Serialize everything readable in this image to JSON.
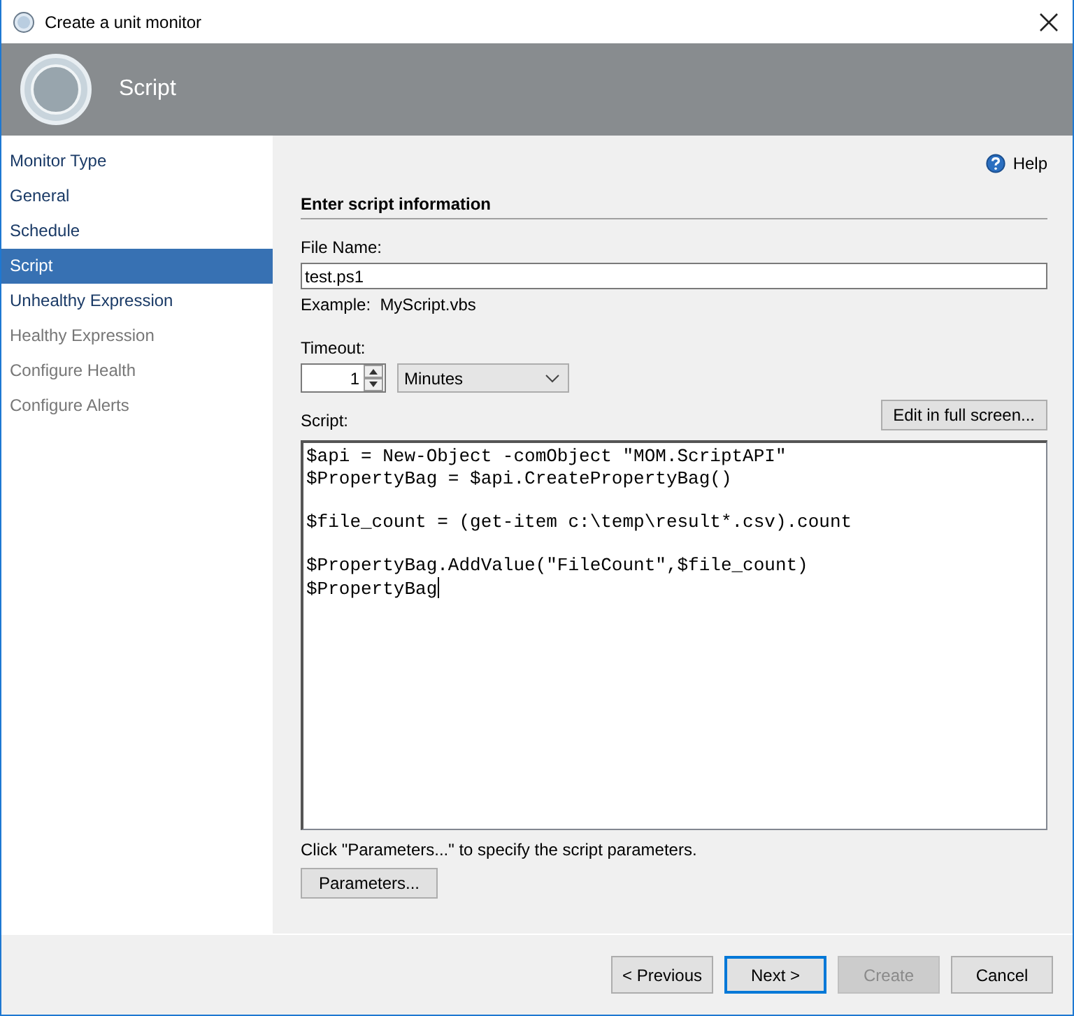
{
  "window": {
    "title": "Create a unit monitor"
  },
  "header": {
    "title": "Script"
  },
  "sidebar": {
    "items": [
      {
        "label": "Monitor Type",
        "selected": false,
        "disabled": false
      },
      {
        "label": "General",
        "selected": false,
        "disabled": false
      },
      {
        "label": "Schedule",
        "selected": false,
        "disabled": false
      },
      {
        "label": "Script",
        "selected": true,
        "disabled": false
      },
      {
        "label": "Unhealthy Expression",
        "selected": false,
        "disabled": false
      },
      {
        "label": "Healthy Expression",
        "selected": false,
        "disabled": true
      },
      {
        "label": "Configure Health",
        "selected": false,
        "disabled": true
      },
      {
        "label": "Configure Alerts",
        "selected": false,
        "disabled": true
      }
    ]
  },
  "help": "Help",
  "section_title": "Enter script information",
  "file_name": {
    "label": "File Name:",
    "value": "test.ps1",
    "example": "Example:  MyScript.vbs"
  },
  "timeout": {
    "label": "Timeout:",
    "value": "1",
    "unit": "Minutes"
  },
  "script": {
    "label": "Script:",
    "edit_button": "Edit in full screen...",
    "code": "$api = New-Object -comObject \"MOM.ScriptAPI\"\n$PropertyBag = $api.CreatePropertyBag()\n\n$file_count = (get-item c:\\temp\\result*.csv).count\n\n$PropertyBag.AddValue(\"FileCount\",$file_count)\n$PropertyBag"
  },
  "parameters": {
    "hint": "Click \"Parameters...\" to specify the script parameters.",
    "button": "Parameters..."
  },
  "buttons": [
    {
      "label": "< Previous",
      "disabled": false,
      "focused": false
    },
    {
      "label": "Next >",
      "disabled": false,
      "focused": true
    },
    {
      "label": "Create",
      "disabled": true,
      "focused": false
    },
    {
      "label": "Cancel",
      "disabled": false,
      "focused": false
    }
  ]
}
